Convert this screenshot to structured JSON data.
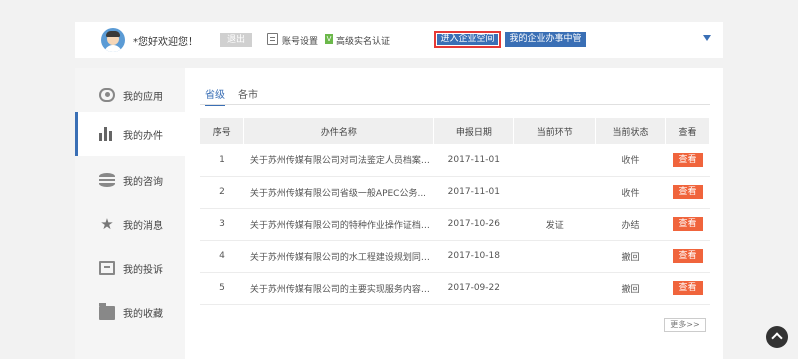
{
  "header": {
    "welcome": "*您好欢迎您！",
    "logout_label": "退出",
    "account_settings": "账号设置",
    "verify_badge": "V",
    "verify_label": "高级实名认证",
    "enter_space_label": "进入企业空间",
    "assistant_label": "我的企业办事中管"
  },
  "sidebar": {
    "items": [
      {
        "label": "我的应用",
        "icon": "eye-icon"
      },
      {
        "label": "我的办件",
        "icon": "bar-chart-icon"
      },
      {
        "label": "我的咨询",
        "icon": "database-icon"
      },
      {
        "label": "我的消息",
        "icon": "star-icon"
      },
      {
        "label": "我的投诉",
        "icon": "message-icon"
      },
      {
        "label": "我的收藏",
        "icon": "folder-icon"
      }
    ],
    "active_index": 1
  },
  "tabs": [
    {
      "label": "省级"
    },
    {
      "label": "各市"
    }
  ],
  "table": {
    "headers": [
      "序号",
      "办件名称",
      "申报日期",
      "当前环节",
      "当前状态",
      "查看"
    ],
    "rows": [
      {
        "no": "1",
        "name": "关于苏州传媒有限公司对司法鉴定人员档案管理",
        "date": "2017-11-01",
        "step": "",
        "status": "收件",
        "action": "查看"
      },
      {
        "no": "2",
        "name": "关于苏州传媒有限公司省级一般APEC公务...",
        "date": "2017-11-01",
        "step": "",
        "status": "收件",
        "action": "查看"
      },
      {
        "no": "3",
        "name": "关于苏州传媒有限公司的特种作业操作证档案...",
        "date": "2017-10-26",
        "step": "发证",
        "status": "办结",
        "action": "查看"
      },
      {
        "no": "4",
        "name": "关于苏州传媒有限公司的水工程建设规划同意...",
        "date": "2017-10-18",
        "step": "",
        "status": "撤回",
        "action": "查看"
      },
      {
        "no": "5",
        "name": "关于苏州传媒有限公司的主要实现服务内容两...",
        "date": "2017-09-22",
        "step": "",
        "status": "撤回",
        "action": "查看"
      }
    ]
  },
  "more_label": "更多>>"
}
